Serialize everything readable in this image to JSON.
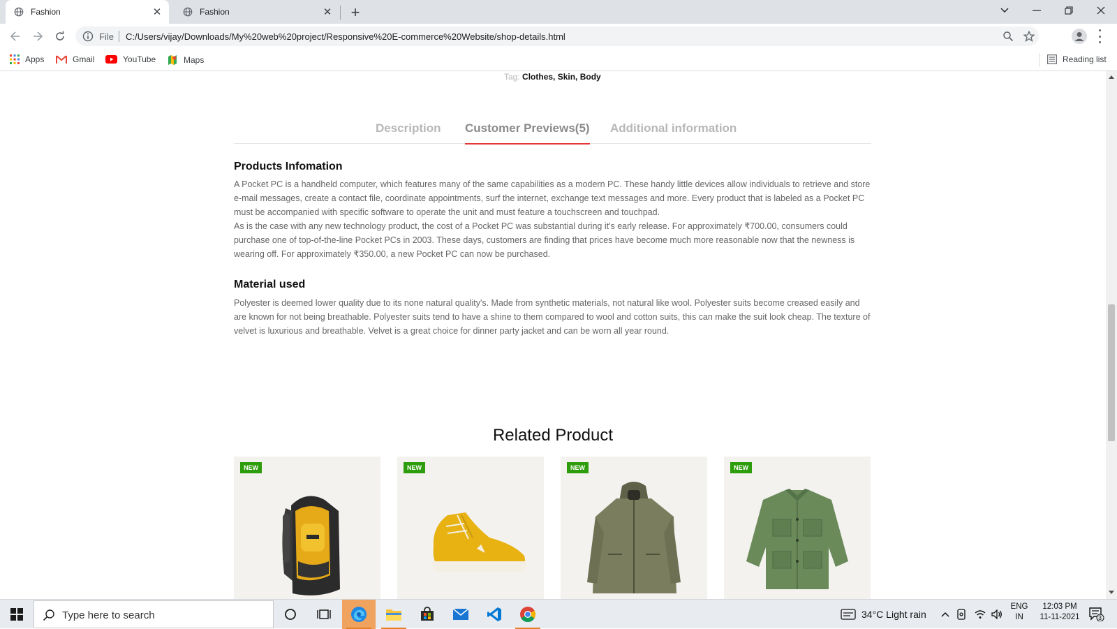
{
  "browser": {
    "tabs": [
      {
        "title": "Fashion",
        "active": true
      },
      {
        "title": "Fashion",
        "active": false
      }
    ],
    "omnibox": {
      "scheme_label": "File",
      "url": "C:/Users/vijay/Downloads/My%20web%20project/Responsive%20E-commerce%20Website/shop-details.html"
    },
    "bookmarks": [
      {
        "label": "Apps",
        "icon": "apps-grid-icon"
      },
      {
        "label": "Gmail",
        "icon": "gmail-icon"
      },
      {
        "label": "YouTube",
        "icon": "youtube-icon"
      },
      {
        "label": "Maps",
        "icon": "maps-icon"
      }
    ],
    "reading_list": "Reading list"
  },
  "page": {
    "tag_label": "Tag:",
    "tag_values": "Clothes, Skin, Body",
    "tabs": [
      {
        "label": "Description",
        "active": false
      },
      {
        "label": "Customer Previews(5)",
        "active": true
      },
      {
        "label": "Additional information",
        "active": false
      }
    ],
    "products_info": {
      "title": "Products Infomation",
      "paragraph1": "A Pocket PC is a handheld computer, which features many of the same capabilities as a modern PC. These handy little devices allow individuals to retrieve and store e-mail messages, create a contact file, coordinate appointments, surf the internet, exchange text messages and more. Every product that is labeled as a Pocket PC must be accompanied with specific software to operate the unit and must feature a touchscreen and touchpad.",
      "paragraph2": "As is the case with any new technology product, the cost of a Pocket PC was substantial during it's early release. For approximately ₹700.00, consumers could purchase one of top-of-the-line Pocket PCs in 2003. These days, customers are finding that prices have become much more reasonable now that the newness is wearing off. For approximately ₹350.00, a new Pocket PC can now be purchased."
    },
    "material": {
      "title": "Material used",
      "paragraph": "Polyester is deemed lower quality due to its none natural quality's. Made from synthetic materials, not natural like wool. Polyester suits become creased easily and are known for not being breathable. Polyester suits tend to have a shine to them compared to wool and cotton suits, this can make the suit look cheap. The texture of velvet is luxurious and breathable. Velvet is a great choice for dinner party jacket and can be worn all year round."
    },
    "related_title": "Related Product",
    "related_products": [
      {
        "badge": "NEW",
        "image": "yellow-backpack"
      },
      {
        "badge": "NEW",
        "image": "yellow-sneaker"
      },
      {
        "badge": "NEW",
        "image": "olive-hooded-jacket"
      },
      {
        "badge": "NEW",
        "image": "green-shirt-jacket"
      }
    ]
  },
  "taskbar": {
    "search_placeholder": "Type here to search",
    "weather": "34°C  Light rain",
    "lang_top": "ENG",
    "lang_bottom": "IN",
    "time": "12:03 PM",
    "date": "11-11-2021",
    "notification_count": "3"
  },
  "colors": {
    "accent_underline": "#e53637",
    "badge_green": "#2e9d0c",
    "taskbar_highlight": "#f0a35e"
  }
}
